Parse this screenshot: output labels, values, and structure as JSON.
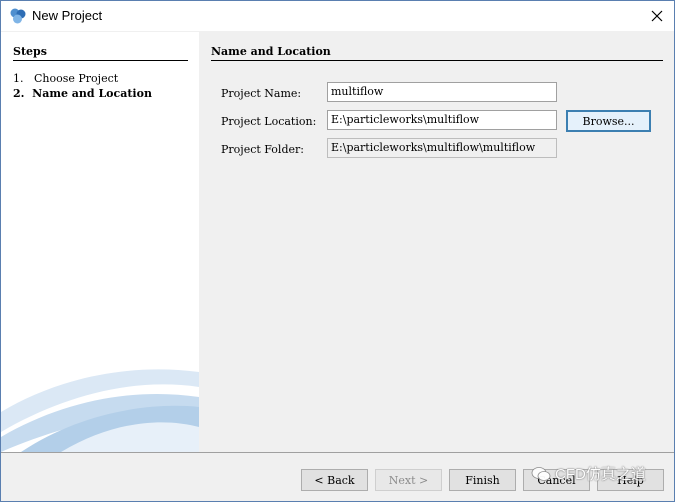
{
  "window": {
    "title": "New Project"
  },
  "steps": {
    "title": "Steps",
    "items": [
      {
        "number": "1.",
        "label": "Choose Project"
      },
      {
        "number": "2.",
        "label": "Name and Location"
      }
    ]
  },
  "section": {
    "title": "Name and Location"
  },
  "form": {
    "project_name": {
      "label": "Project Name:",
      "value": "multiflow"
    },
    "project_location": {
      "label": "Project Location:",
      "value": "E:\\particleworks\\multiflow"
    },
    "project_folder": {
      "label": "Project Folder:",
      "value": "E:\\particleworks\\multiflow\\multiflow"
    },
    "browse_label": "Browse..."
  },
  "buttons": {
    "back": "< Back",
    "next": "Next >",
    "finish": "Finish",
    "cancel": "Cancel",
    "help": "Help"
  },
  "watermark": {
    "text": "CFD仿真之道"
  }
}
